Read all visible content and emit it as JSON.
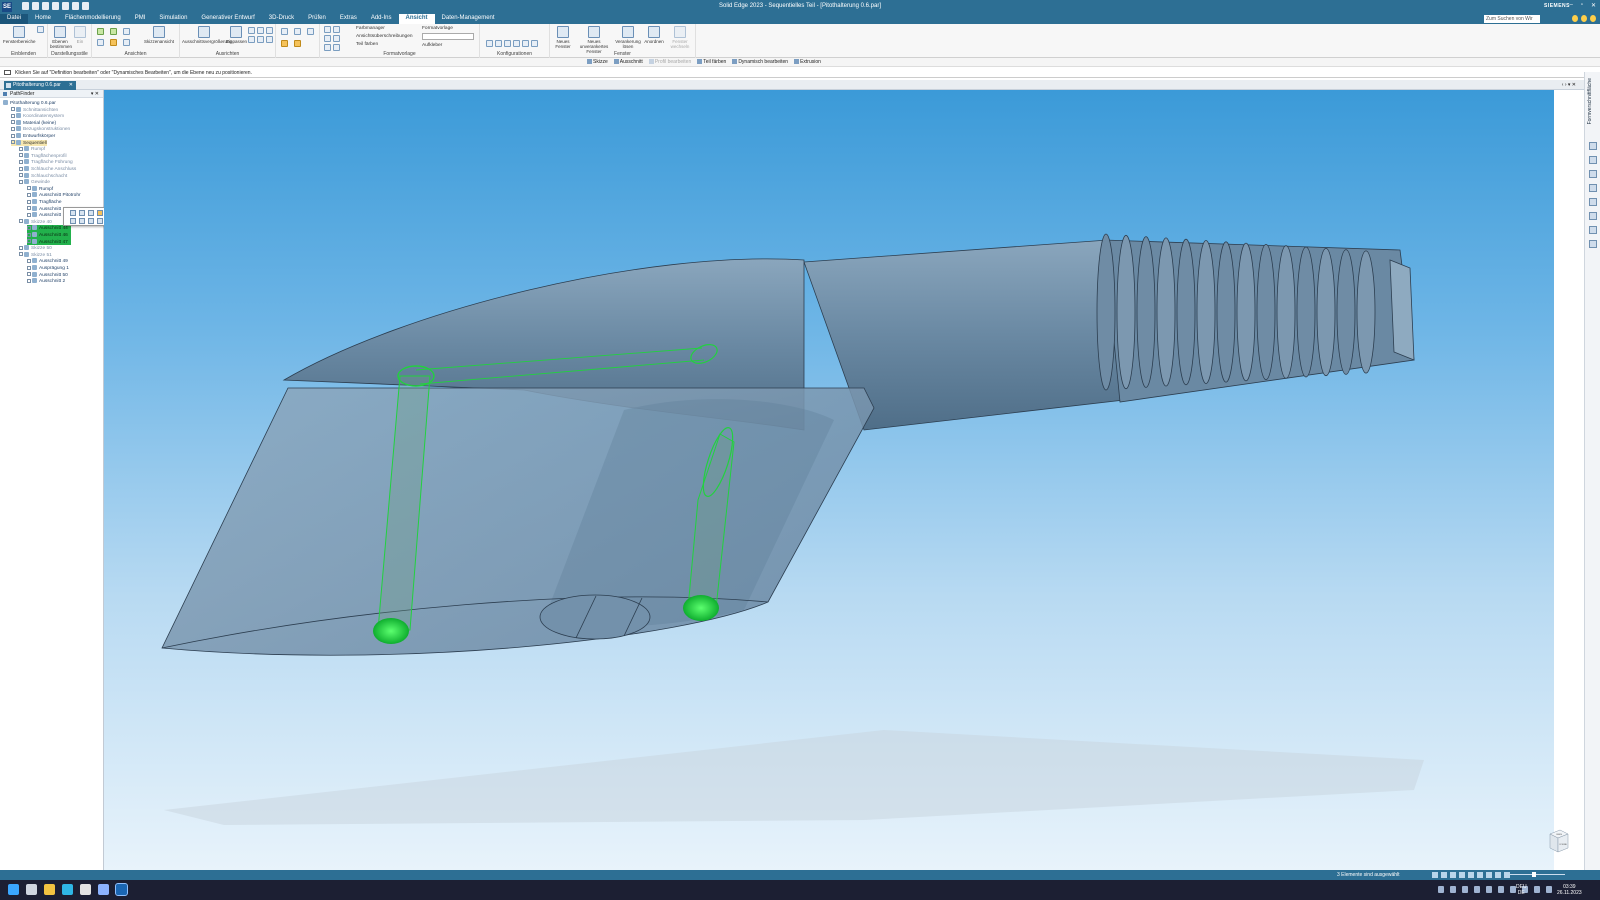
{
  "titlebar": {
    "logo": "SE",
    "title": "Solid Edge 2023 - Sequentielles Teil - [Pitothalterung 0.6.par]",
    "brand": "SIEMENS",
    "minimize": "–",
    "restore": "▫",
    "close": "✕"
  },
  "menu": {
    "tabs": [
      "Datei",
      "Home",
      "Flächenmodellierung",
      "PMI",
      "Simulation",
      "Generativer Entwurf",
      "3D-Druck",
      "Prüfen",
      "Extras",
      "Add-Ins",
      "Ansicht",
      "Daten-Management"
    ],
    "active": "Ansicht",
    "search_placeholder": "Zum Suchen von Wir"
  },
  "ribbon": {
    "groups": {
      "einblenden": "Einblenden",
      "darstellungsstile": "Darstellungsstile",
      "ansichten": "Ansichten",
      "ausrichten": "Ausrichten",
      "formatvorlage": "Formatvorlage",
      "konfigurationen": "Konfigurationen",
      "fenster": "Fenster"
    },
    "buttons": {
      "fensterbereiche": "Fensterbereiche",
      "ebenen_bestimmen": "Ebenen bestimmen",
      "ein": "Ein",
      "skizzenansicht": "Skizzenansicht",
      "ausschnittsvergroesserung": "Ausschnittsvergrößerung",
      "einpassen": "Einpassen",
      "farbmanager": "Farbmanager",
      "ansichtsueberschreibungen": "Ansichtsüberschreibungen",
      "teil_faerben": "Teil färben",
      "formatvorlage": "Formatvorlage",
      "aufkleber": "Aufkleber",
      "neues_fenster": "Neues Fenster",
      "neues_unverankertes_fenster": "Neues unverankertes Fenster",
      "verankerung_losen": "Verankerung lösen",
      "anordnen": "Anordnen",
      "fenster_wechseln": "Fenster wechseln"
    }
  },
  "cmdbar": {
    "items": [
      {
        "label": "Skizze",
        "enabled": true
      },
      {
        "label": "Ausschnitt",
        "enabled": true
      },
      {
        "label": "Profil bearbeiten",
        "enabled": false
      },
      {
        "label": "Teil färben",
        "enabled": true
      },
      {
        "label": "Dynamisch bearbeiten",
        "enabled": true
      },
      {
        "label": "Extrusion",
        "enabled": true
      }
    ]
  },
  "prompt": "Klicken Sie auf \"Definition bearbeiten\" oder \"Dynamisches Bearbeiten\", um die Ebene neu zu positionieren.",
  "doctab": {
    "label": "Pitothalterung 0.6.par",
    "close": "✕",
    "controls": "‹ › ▾ ✕"
  },
  "pathfinder": {
    "title": "PathFinder",
    "header_controls": "▾ ✕",
    "tree": [
      {
        "label": "Pitothalterung 0.6.par",
        "indent": 0,
        "style": "normal"
      },
      {
        "label": "Schnittansichten",
        "indent": 1,
        "style": "gray"
      },
      {
        "label": "Koordinatensystem",
        "indent": 1,
        "style": "gray"
      },
      {
        "label": "Material (keine)",
        "indent": 1,
        "style": "normal"
      },
      {
        "label": "Bezugskonstruktionen",
        "indent": 1,
        "style": "gray"
      },
      {
        "label": "Entwurfskörper",
        "indent": 1,
        "style": "normal"
      },
      {
        "label": "Sequentiell",
        "indent": 1,
        "style": "sel"
      },
      {
        "label": "Rumpf",
        "indent": 2,
        "style": "gray"
      },
      {
        "label": "Tragflächenprofil",
        "indent": 2,
        "style": "gray"
      },
      {
        "label": "Tragfläche Führung",
        "indent": 2,
        "style": "gray"
      },
      {
        "label": "Schläuche Anschluss",
        "indent": 2,
        "style": "gray"
      },
      {
        "label": "Schlauchschacht",
        "indent": 2,
        "style": "gray"
      },
      {
        "label": "Gewinde",
        "indent": 2,
        "style": "gray"
      },
      {
        "label": "Rumpf",
        "indent": 3,
        "style": "normal"
      },
      {
        "label": "Ausschnitt Pitotrohr",
        "indent": 3,
        "style": "normal"
      },
      {
        "label": "Tragfläche",
        "indent": 3,
        "style": "normal"
      },
      {
        "label": "Ausschnitt",
        "indent": 3,
        "style": "normal"
      },
      {
        "label": "Ausschnitt",
        "indent": 3,
        "style": "normal"
      },
      {
        "label": "Skizze 40",
        "indent": 2,
        "style": "gray"
      },
      {
        "label": "Ausschnitt 44",
        "indent": 3,
        "style": "hl"
      },
      {
        "label": "Ausschnitt 46",
        "indent": 3,
        "style": "hl"
      },
      {
        "label": "Ausschnitt 47",
        "indent": 3,
        "style": "hl"
      },
      {
        "label": "Skizze 50",
        "indent": 2,
        "style": "gray"
      },
      {
        "label": "Skizze 51",
        "indent": 2,
        "style": "gray"
      },
      {
        "label": "Ausschnitt 49",
        "indent": 3,
        "style": "normal"
      },
      {
        "label": "Ausprägung 1",
        "indent": 3,
        "style": "normal"
      },
      {
        "label": "Ausschnitt 50",
        "indent": 3,
        "style": "normal"
      },
      {
        "label": "Ausschnitt 2",
        "indent": 3,
        "style": "normal"
      }
    ]
  },
  "right_panel_label": "Formverschnittfläche",
  "viewcube": {
    "top": "OBEN",
    "front": "VORNE"
  },
  "status": {
    "text": "3 Elemente sind ausgewählt"
  },
  "taskbar": {
    "lang_top": "DEU",
    "lang_bottom": "DE",
    "time": "03:39",
    "date": "26.11.2023"
  },
  "colors": {
    "accent": "#2d6f94",
    "part": "#6f8ea8",
    "selection": "#22b14c",
    "viewport_top": "#3b9ad8",
    "viewport_bottom": "#e8f3fb"
  }
}
